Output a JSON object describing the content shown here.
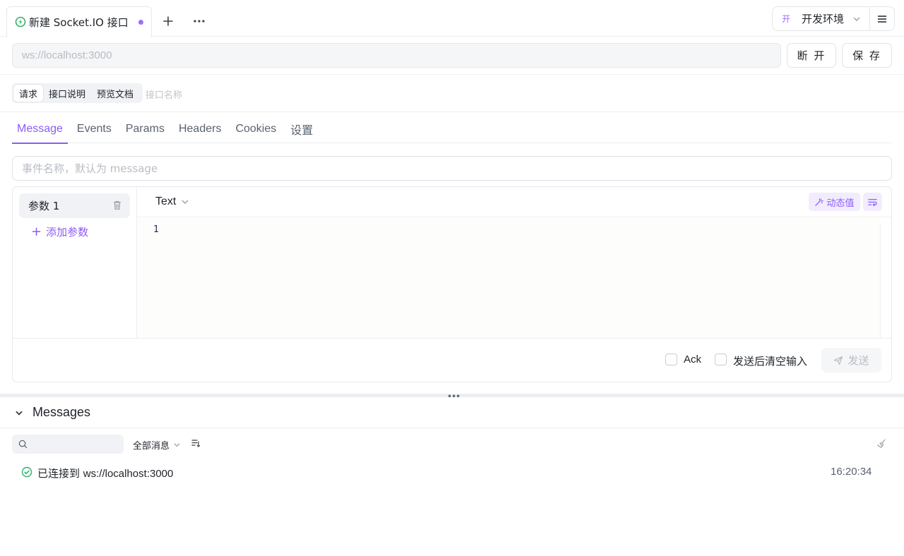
{
  "tab": {
    "title": "新建 Socket.IO 接口",
    "unsaved": true
  },
  "env": {
    "badge": "开",
    "label": "开发环境"
  },
  "url": {
    "placeholder": "ws://localhost:3000"
  },
  "buttons": {
    "disconnect": "断 开",
    "save": "保 存"
  },
  "segments": [
    {
      "label": "请求",
      "active": true
    },
    {
      "label": "接口说明",
      "active": false
    },
    {
      "label": "预览文档",
      "active": false
    }
  ],
  "api_name_placeholder": "接口名称",
  "subtabs": [
    "Message",
    "Events",
    "Params",
    "Headers",
    "Cookies",
    "设置"
  ],
  "active_subtab": "Message",
  "event_name_placeholder": "事件名称，默认为 message",
  "params": {
    "items": [
      "参数 1"
    ],
    "add_label": "添加参数"
  },
  "editor": {
    "format": "Text",
    "dynamic_value_label": "动态值",
    "line_numbers": [
      "1"
    ]
  },
  "footer": {
    "ack_label": "Ack",
    "clear_after_send_label": "发送后清空输入",
    "send_label": "发送"
  },
  "messages": {
    "title": "Messages",
    "filter_label": "全部消息",
    "rows": [
      {
        "status": "connected",
        "text_prefix": "已连接到 ",
        "url": "ws://localhost:3000",
        "time": "16:20:34"
      }
    ]
  },
  "colors": {
    "accent": "#8a5cf5",
    "success": "#2fb36a"
  }
}
